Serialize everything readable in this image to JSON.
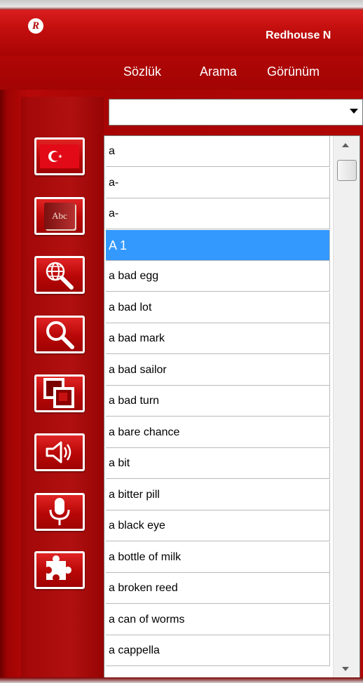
{
  "app": {
    "title": "Redhouse N",
    "logo_letter": "R"
  },
  "menu": {
    "items": [
      "Sözlük",
      "Arama",
      "Görünüm"
    ]
  },
  "search": {
    "value": "",
    "placeholder": ""
  },
  "sidebar": {
    "buttons": [
      {
        "icon": "turkish-flag-icon"
      },
      {
        "icon": "abc-book-icon",
        "label": "Abc"
      },
      {
        "icon": "globe-search-icon"
      },
      {
        "icon": "magnifier-icon"
      },
      {
        "icon": "squares-icon"
      },
      {
        "icon": "speaker-icon"
      },
      {
        "icon": "microphone-icon"
      },
      {
        "icon": "puzzle-icon"
      }
    ]
  },
  "word_list": {
    "selected_index": 3,
    "items": [
      "a",
      "a-",
      "a-",
      "A 1",
      "a bad egg",
      "a bad lot",
      "a bad mark",
      "a bad sailor",
      "a bad turn",
      "a bare chance",
      "a bit",
      "a bitter pill",
      "a black eye",
      "a bottle of milk",
      "a broken reed",
      "a can of worms",
      "a cappella"
    ]
  },
  "colors": {
    "primary_red": "#b00606",
    "selection_blue": "#3399ff"
  }
}
